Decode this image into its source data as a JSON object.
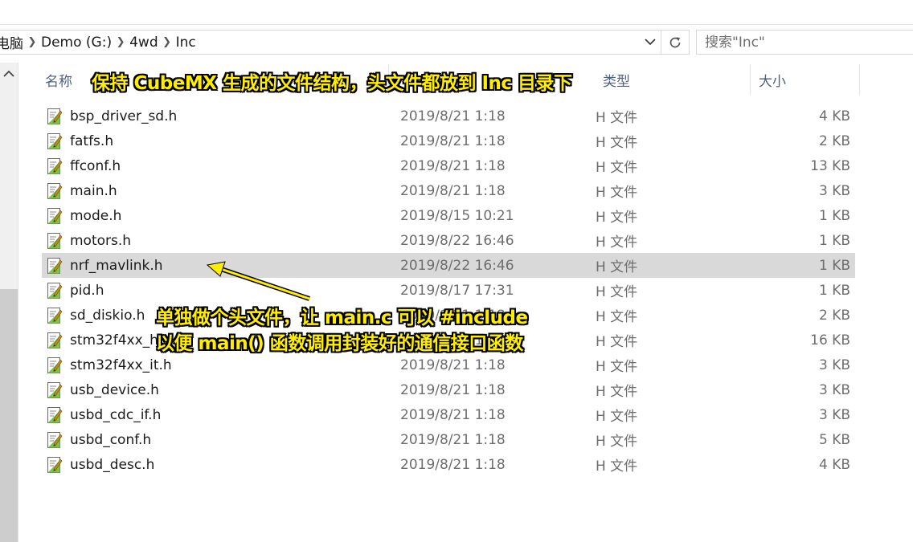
{
  "breadcrumb": {
    "items": [
      "电脑",
      "Demo (G:)",
      "4wd",
      "Inc"
    ]
  },
  "search": {
    "placeholder": "搜索\"Inc\""
  },
  "columns": {
    "name": "名称",
    "type": "类型",
    "size": "大小"
  },
  "files": [
    {
      "name": "bsp_driver_sd.h",
      "date": "2019/8/21 1:18",
      "type": "H 文件",
      "size": "4 KB",
      "selected": false
    },
    {
      "name": "fatfs.h",
      "date": "2019/8/21 1:18",
      "type": "H 文件",
      "size": "2 KB",
      "selected": false
    },
    {
      "name": "ffconf.h",
      "date": "2019/8/21 1:18",
      "type": "H 文件",
      "size": "13 KB",
      "selected": false
    },
    {
      "name": "main.h",
      "date": "2019/8/21 1:18",
      "type": "H 文件",
      "size": "3 KB",
      "selected": false
    },
    {
      "name": "mode.h",
      "date": "2019/8/15 10:21",
      "type": "H 文件",
      "size": "1 KB",
      "selected": false
    },
    {
      "name": "motors.h",
      "date": "2019/8/22 16:46",
      "type": "H 文件",
      "size": "1 KB",
      "selected": false
    },
    {
      "name": "nrf_mavlink.h",
      "date": "2019/8/22 16:46",
      "type": "H 文件",
      "size": "1 KB",
      "selected": true
    },
    {
      "name": "pid.h",
      "date": "2019/8/17 17:31",
      "type": "H 文件",
      "size": "1 KB",
      "selected": false
    },
    {
      "name": "sd_diskio.h",
      "date": "2019/8/21 1:18",
      "type": "H 文件",
      "size": "2 KB",
      "selected": false
    },
    {
      "name": "stm32f4xx_h",
      "date": "2019/8/21 1:18",
      "type": "H 文件",
      "size": "16 KB",
      "selected": false
    },
    {
      "name": "stm32f4xx_it.h",
      "date": "2019/8/21 1:18",
      "type": "H 文件",
      "size": "3 KB",
      "selected": false
    },
    {
      "name": "usb_device.h",
      "date": "2019/8/21 1:18",
      "type": "H 文件",
      "size": "3 KB",
      "selected": false
    },
    {
      "name": "usbd_cdc_if.h",
      "date": "2019/8/21 1:18",
      "type": "H 文件",
      "size": "3 KB",
      "selected": false
    },
    {
      "name": "usbd_conf.h",
      "date": "2019/8/21 1:18",
      "type": "H 文件",
      "size": "5 KB",
      "selected": false
    },
    {
      "name": "usbd_desc.h",
      "date": "2019/8/21 1:18",
      "type": "H 文件",
      "size": "4 KB",
      "selected": false
    }
  ],
  "annotations": {
    "top": "保持 CubeMX 生成的文件结构，头文件都放到 Inc 目录下",
    "mid_line1": "单独做个头文件，让 main.c 可以 #include",
    "mid_line2": "以便 main() 函数调用封装好的通信接口函数"
  },
  "icons": {
    "file": "h-file-icon",
    "dropdown": "chevron-down-icon",
    "refresh": "refresh-icon",
    "nav_up": "chevron-up-icon"
  },
  "colors": {
    "annotation_text": "#ffee00",
    "annotation_outline": "#000000",
    "selection": "#d9d9d9",
    "header_text": "#4d6082",
    "arrow": "#ffee00"
  }
}
